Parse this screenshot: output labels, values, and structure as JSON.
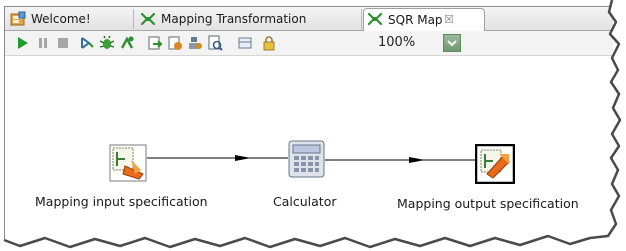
{
  "tabs": [
    {
      "label": "Welcome!",
      "icon": "welcome-icon"
    },
    {
      "label": "Mapping Transformation",
      "icon": "mapping-icon"
    },
    {
      "label": "SQR Map",
      "icon": "mapping-icon",
      "active": true,
      "close": "☒"
    }
  ],
  "toolbar": {
    "buttons": [
      "run-icon",
      "pause-icon",
      "stop-icon",
      "step-icon",
      "debug-icon",
      "breakpoint-icon",
      "export-icon",
      "import-icon",
      "deploy-icon",
      "report-icon",
      "layout-icon",
      "lock-icon"
    ],
    "zoom_value": "100%"
  },
  "diagram": {
    "nodes": [
      {
        "label": "Mapping input specification",
        "icon": "input-spec-icon"
      },
      {
        "label": "Calculator",
        "icon": "calculator-icon"
      },
      {
        "label": "Mapping output specification",
        "icon": "output-spec-icon"
      }
    ]
  },
  "colors": {
    "accent_green": "#2f8f2f",
    "tab_active_bg": "#ffffff"
  }
}
